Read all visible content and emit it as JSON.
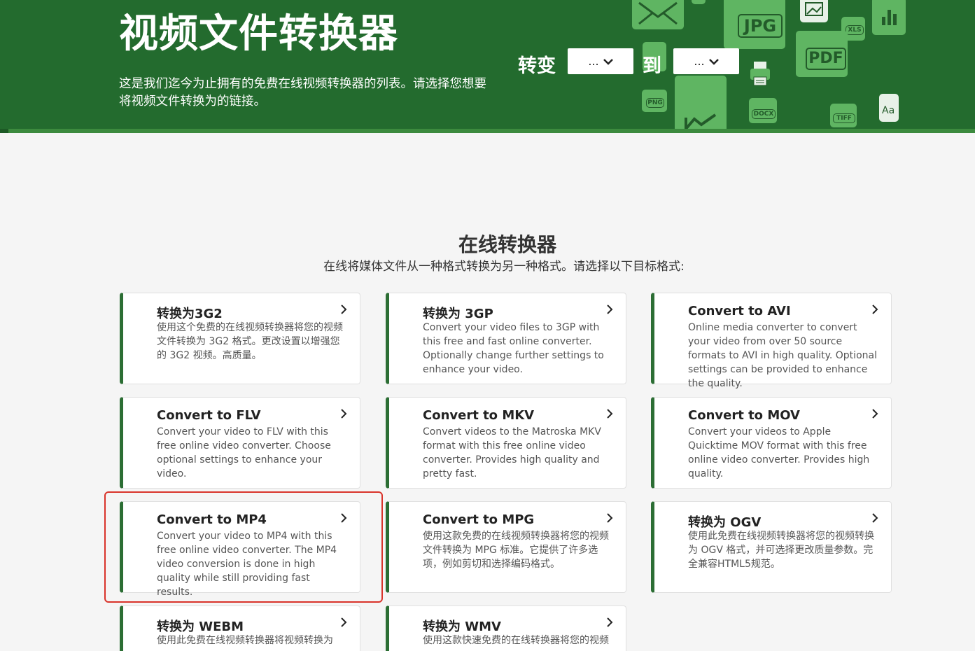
{
  "hero": {
    "title": "视频文件转换器",
    "description": "这是我们迄今为止拥有的免费在线视频转换器的列表。请选择您想要将视频文件转换为的链接。",
    "convert_label": "转变",
    "to_label": "到",
    "from_select_value": "...",
    "to_select_value": "...",
    "deco_labels": {
      "jpg": "JPG",
      "pdf": "PDF",
      "xls": "XLS",
      "png": "PNG",
      "docx": "DOCX",
      "tiff": "TIFF",
      "font": "Aa"
    }
  },
  "section": {
    "title": "在线转换器",
    "subtitle": "在线将媒体文件从一种格式转换为另一种格式。请选择以下目标格式:"
  },
  "cards": [
    {
      "title": "转换为3G2",
      "desc": "使用这个免费的在线视频转换器将您的视频文件转换为 3G2 格式。更改设置以增强您的 3G2 视频。高质量。"
    },
    {
      "title": "转换为 3GP",
      "desc": "Convert your video files to 3GP with this free and fast online converter. Optionally change further settings to enhance your video."
    },
    {
      "title": "Convert to AVI",
      "desc": "Online media converter to convert your video from over 50 source formats to AVI in high quality. Optional settings can be provided to enhance the quality."
    },
    {
      "title": "Convert to FLV",
      "desc": "Convert your video to FLV with this free online video converter. Choose optional settings to enhance your video."
    },
    {
      "title": "Convert to MKV",
      "desc": "Convert videos to the Matroska MKV format with this free online video converter. Provides high quality and pretty fast."
    },
    {
      "title": "Convert to MOV",
      "desc": "Convert your videos to Apple Quicktime MOV format with this free online video converter. Provides high quality."
    },
    {
      "title": "Convert to MP4",
      "desc": "Convert your video to MP4 with this free online video converter. The MP4 video conversion is done in high quality while still providing fast results."
    },
    {
      "title": "Convert to MPG",
      "desc": "使用这款免费的在线视频转换器将您的视频文件转换为 MPG 标准。它提供了许多选项，例如剪切和选择编码格式。"
    },
    {
      "title": "转换为 OGV",
      "desc": "使用此免费在线视频转换器将您的视频转换为 OGV 格式，并可选择更改质量参数。完全兼容HTML5规范。"
    },
    {
      "title": "转换为 WEBM",
      "desc": "使用此免费在线视频转换器将视频转换为"
    },
    {
      "title": "转换为 WMV",
      "desc": "使用这款快速免费的在线转换器将您的视频"
    }
  ],
  "colors": {
    "hero_bg": "#236b2e",
    "card_accent": "#2c6e34",
    "highlight": "#d9342b"
  }
}
